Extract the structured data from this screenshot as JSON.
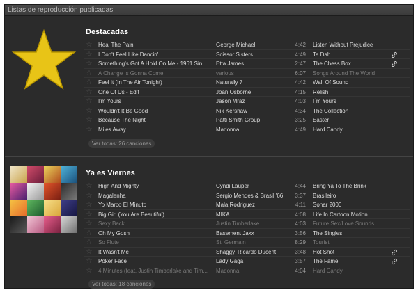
{
  "window": {
    "title": "Listas de reproducción publicadas"
  },
  "colors": {
    "star": "#e8c417",
    "background": "#2b2b2b",
    "text": "#dcdcdc",
    "dim_text": "#7a7a7a"
  },
  "playlists": [
    {
      "title": "Destacadas",
      "cover_icon": "star-icon",
      "see_all": "Ver todas: 26 canciones",
      "tracks": [
        {
          "name": "Heal The Pain",
          "artist": "George Michael",
          "time": "4:42",
          "album": "Listen Without Prejudice",
          "dim": false,
          "link": false
        },
        {
          "name": "I Don't Feel Like Dancin'",
          "artist": "Scissor Sisters",
          "time": "4:49",
          "album": "Ta Dah",
          "dim": false,
          "link": true
        },
        {
          "name": "Something's Got A Hold On Me - 1961 Sing...",
          "artist": "Etta James",
          "time": "2:47",
          "album": "The Chess Box",
          "dim": false,
          "link": true
        },
        {
          "name": "A Change Is Gonna Come",
          "artist": "various",
          "time": "6:07",
          "album": "Songs Around The World",
          "dim": true,
          "link": false
        },
        {
          "name": "Feel It (In The Air Tonight)",
          "artist": "Naturally 7",
          "time": "4:42",
          "album": "Wall Of Sound",
          "dim": false,
          "link": false
        },
        {
          "name": "One Of Us - Edit",
          "artist": "Joan Osborne",
          "time": "4:15",
          "album": "Relish",
          "dim": false,
          "link": false
        },
        {
          "name": "I'm Yours",
          "artist": "Jason Mraz",
          "time": "4:03",
          "album": "I´m Yours",
          "dim": false,
          "link": false
        },
        {
          "name": "Wouldn't It Be Good",
          "artist": "Nik Kershaw",
          "time": "4:34",
          "album": "The Collection",
          "dim": false,
          "link": false
        },
        {
          "name": "Because The Night",
          "artist": "Patti Smith Group",
          "time": "3:25",
          "album": "Easter",
          "dim": false,
          "link": false
        },
        {
          "name": "Miles Away",
          "artist": "Madonna",
          "time": "4:49",
          "album": "Hard Candy",
          "dim": false,
          "link": false
        }
      ]
    },
    {
      "title": "Ya es Viernes",
      "cover_icon": "album-mosaic-image",
      "see_all": "Ver todas: 18 canciones",
      "tracks": [
        {
          "name": "High And Mighty",
          "artist": "Cyndi Lauper",
          "time": "4:44",
          "album": "Bring Ya To The Brink",
          "dim": false,
          "link": false
        },
        {
          "name": "Magalenha",
          "artist": "Sergio Mendes & Brasil '66",
          "time": "3:37",
          "album": "Brasileiro",
          "dim": false,
          "link": false
        },
        {
          "name": "Yo Marco El Minuto",
          "artist": "Mala Rodriguez",
          "time": "4:11",
          "album": "Sonar 2000",
          "dim": false,
          "link": false
        },
        {
          "name": "Big Girl (You Are Beautiful)",
          "artist": "MIKA",
          "time": "4:08",
          "album": "Life In Cartoon Motion",
          "dim": false,
          "link": false
        },
        {
          "name": "Sexy Back",
          "artist": "Justin Timberlake",
          "time": "4:03",
          "album": "Future Sex/Love Sounds",
          "dim": true,
          "link": false
        },
        {
          "name": "Oh My Gosh",
          "artist": "Basement Jaxx",
          "time": "3:56",
          "album": "The Singles",
          "dim": false,
          "link": false
        },
        {
          "name": "So Flute",
          "artist": "St. Germain",
          "time": "8:29",
          "album": "Tourist",
          "dim": true,
          "link": false
        },
        {
          "name": "It Wasn't Me",
          "artist": "Shaggy, Ricardo Ducent",
          "time": "3:48",
          "album": "Hot Shot",
          "dim": false,
          "link": true
        },
        {
          "name": "Poker Face",
          "artist": "Lady Gaga",
          "time": "3:57",
          "album": "The Fame",
          "dim": false,
          "link": true
        },
        {
          "name": "4 Minutes (feat. Justin Timberlake and Tim...",
          "artist": "Madonna",
          "time": "4:04",
          "album": "Hard Candy",
          "dim": true,
          "link": false
        }
      ]
    }
  ]
}
